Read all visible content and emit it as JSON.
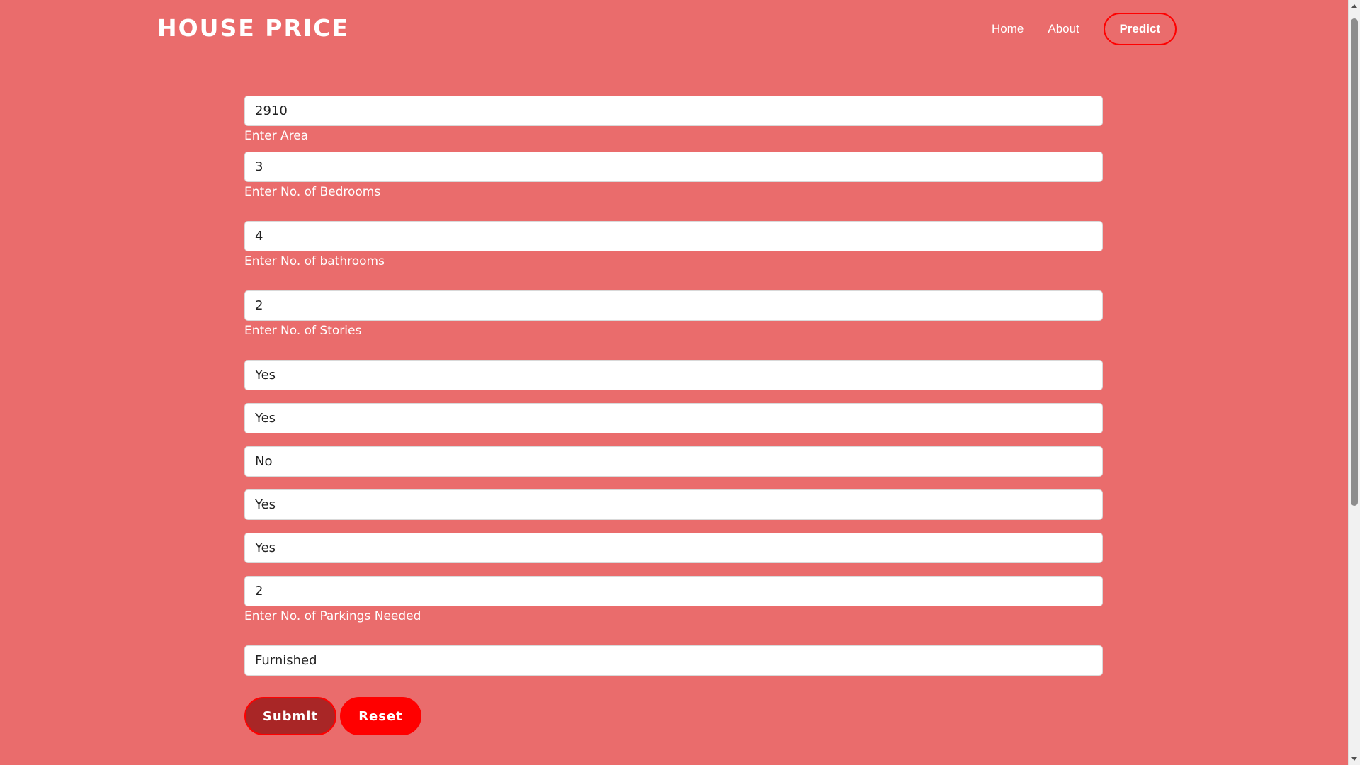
{
  "header": {
    "brand": "HOUSE PRICE",
    "nav": {
      "home": "Home",
      "about": "About",
      "predict": "Predict"
    }
  },
  "form": {
    "area": {
      "value": "2910",
      "label": "Enter Area"
    },
    "bedrooms": {
      "value": "3",
      "label": "Enter No. of Bedrooms"
    },
    "bathrooms": {
      "value": "4",
      "label": "Enter No. of bathrooms"
    },
    "stories": {
      "value": "2",
      "label": "Enter No. of Stories"
    },
    "select1": {
      "value": "Yes"
    },
    "select2": {
      "value": "Yes"
    },
    "select3": {
      "value": "No"
    },
    "select4": {
      "value": "Yes"
    },
    "select5": {
      "value": "Yes"
    },
    "parking": {
      "value": "2",
      "label": "Enter No. of Parkings Needed"
    },
    "furnishing": {
      "value": "Furnished"
    },
    "submit_label": "Submit",
    "reset_label": "Reset"
  },
  "colors": {
    "background": "#ea6c6c",
    "accent": "#ff0000",
    "submit_bg": "#a92626"
  }
}
